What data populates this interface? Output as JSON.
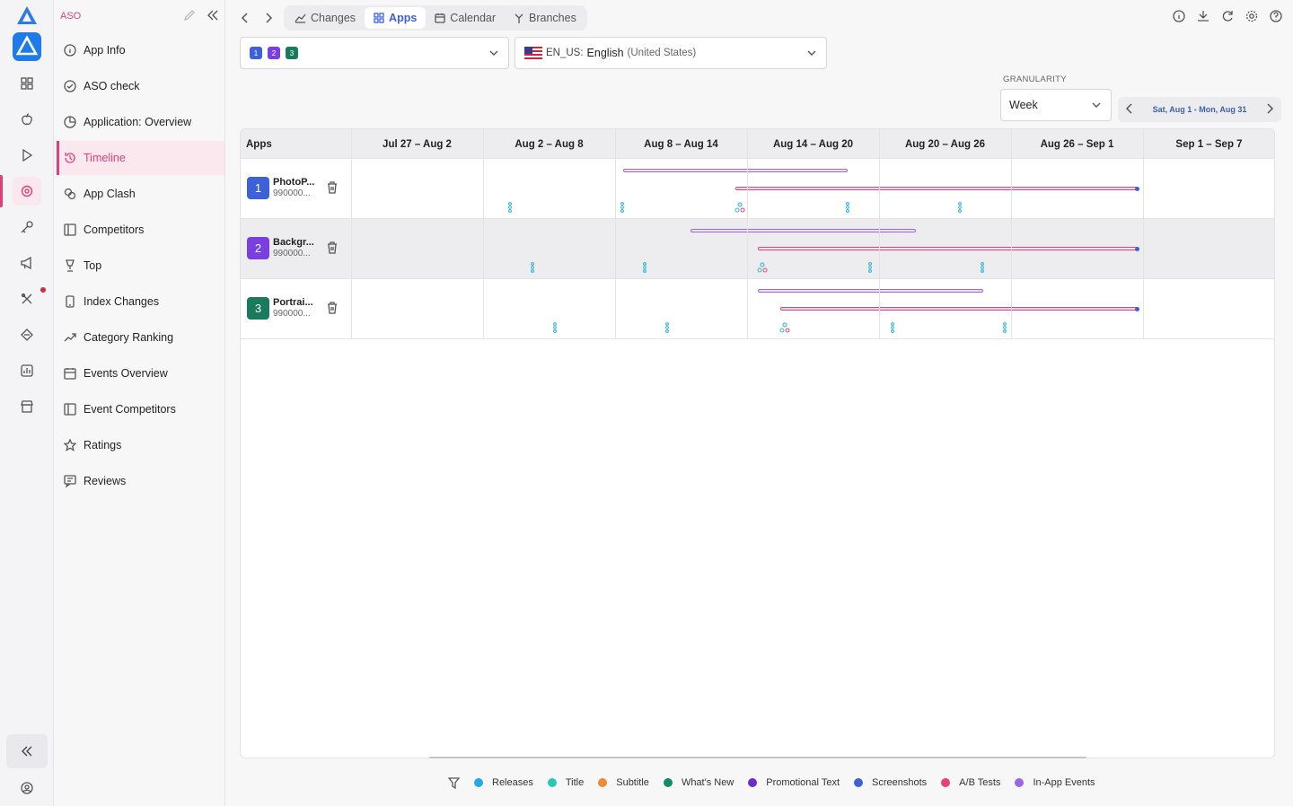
{
  "sidebar": {
    "title": "ASO",
    "items": [
      {
        "label": "App Info",
        "icon": "info-icon"
      },
      {
        "label": "ASO check",
        "icon": "check-circle-icon"
      },
      {
        "label": "Application: Overview",
        "icon": "pie-icon"
      },
      {
        "label": "Timeline",
        "icon": "history-icon",
        "active": true
      },
      {
        "label": "App Clash",
        "icon": "clash-icon"
      },
      {
        "label": "Competitors",
        "icon": "competitors-icon"
      },
      {
        "label": "Top",
        "icon": "trophy-icon"
      },
      {
        "label": "Index Changes",
        "icon": "phone-icon"
      },
      {
        "label": "Category Ranking",
        "icon": "trend-icon"
      },
      {
        "label": "Events Overview",
        "icon": "calendar-icon"
      },
      {
        "label": "Event Competitors",
        "icon": "competitors-icon"
      },
      {
        "label": "Ratings",
        "icon": "star-icon"
      },
      {
        "label": "Reviews",
        "icon": "reviews-icon"
      }
    ]
  },
  "toolbar": {
    "tabs": [
      {
        "label": "Changes",
        "icon": "chart-line-icon"
      },
      {
        "label": "Apps",
        "icon": "apps-icon",
        "active": true
      },
      {
        "label": "Calendar",
        "icon": "calendar-icon"
      },
      {
        "label": "Branches",
        "icon": "branch-icon"
      }
    ]
  },
  "filters": {
    "app_chips": [
      {
        "n": "1",
        "color": "#3d62d8"
      },
      {
        "n": "2",
        "color": "#7a3fe0"
      },
      {
        "n": "3",
        "color": "#1a7a5c"
      }
    ],
    "locale_code": "EN_US:",
    "locale_lang": "English",
    "locale_region": "(United States)",
    "granularity_label": "GRANULARITY",
    "granularity_value": "Week",
    "date_range": "Sat, Aug 1 - Mon, Aug 31"
  },
  "grid": {
    "apps_header": "Apps",
    "weeks": [
      "Jul 27 – Aug 2",
      "Aug 2 – Aug 8",
      "Aug 8 – Aug 14",
      "Aug 14 – Aug 20",
      "Aug 20 – Aug 26",
      "Aug 26 – Sep 1",
      "Sep 1 – Sep 7"
    ],
    "apps": [
      {
        "num": "1",
        "name": "PhotoP...",
        "id": "990000...",
        "color": "#3d62d8"
      },
      {
        "num": "2",
        "name": "Backgr...",
        "id": "990000...",
        "color": "#7a3fe0"
      },
      {
        "num": "3",
        "name": "Portrai...",
        "id": "990000...",
        "color": "#1a7a5c"
      }
    ]
  },
  "legend": [
    {
      "label": "Releases",
      "color": "#29a9e0"
    },
    {
      "label": "Title",
      "color": "#2ec4b6"
    },
    {
      "label": "Subtitle",
      "color": "#f08a34"
    },
    {
      "label": "What's New",
      "color": "#138a6a"
    },
    {
      "label": "Promotional Text",
      "color": "#6a2fc4"
    },
    {
      "label": "Screenshots",
      "color": "#3d62d8"
    },
    {
      "label": "A/B Tests",
      "color": "#e9407d"
    },
    {
      "label": "In-App Events",
      "color": "#9966e8"
    }
  ]
}
